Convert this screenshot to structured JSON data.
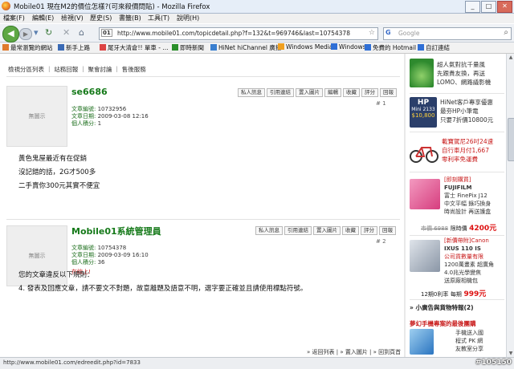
{
  "window": {
    "title": "Mobile01 現在M2的價位怎樣?(可來殺價問貼) - Mozilla Firefox"
  },
  "menu": [
    "檔案(F)",
    "編輯(E)",
    "檢視(V)",
    "歷史(S)",
    "書籤(B)",
    "工具(T)",
    "說明(H)"
  ],
  "nav": {
    "url": "http://www.mobile01.com/topicdetail.php?f=132&t=969746&last=10754378",
    "search_placeholder": "Google",
    "favicon_text": "01"
  },
  "bookmarks": [
    "最常瀏覽的網站",
    "新手上路",
    "尾牙大清倉!! 單車 - ...",
    "即時新聞",
    "HiNet hiChannel 廣播",
    "Windows Media",
    "Windows",
    "免費的 Hotmail",
    "自訂連結"
  ],
  "breadcrumb": "檢視分區列表 ｜ 站務回報 ｜ 聚會討論 ｜ 售後服務",
  "action_buttons": [
    "私人訊息",
    "引用連結",
    "置入圖片",
    "編輯",
    "收藏",
    "評分",
    "回報"
  ],
  "action_buttons_2": [
    "私人訊息",
    "引用連結",
    "置入圖片",
    "收藏",
    "評分",
    "回報"
  ],
  "posts": [
    {
      "author": "se6686",
      "avatar_text": "無圖示",
      "article_id_label": "文章編號:",
      "article_id": "10732956",
      "date_label": "文章日期:",
      "date": "2009-03-08 12:16",
      "points_label": "個人積分:",
      "points": "1",
      "post_no": "# 1",
      "lines": [
        "黃色鬼屋最近有在促銷",
        "沒記錯的話，2G才500多",
        "二手賣你300元其實不便宜"
      ]
    },
    {
      "author": "Mobile01系統管理員",
      "avatar_text": "無圖示",
      "article_id_label": "文章編號:",
      "article_id": "10754378",
      "date_label": "文章日期:",
      "date": "2009-03-09 16:10",
      "points_label": "個人積分:",
      "points": "36",
      "status": "在線上!",
      "post_no": "# 2",
      "lines": [
        "您的文章違反以下規則：",
        "4. 發表及回應文章，請不要文不對題，故意離題及語意不明，選字要正確並且請使用標點符號。"
      ]
    }
  ],
  "bottom_nav": "» 返回列表 | » 置入圖片 | » 回到頁首",
  "sidebar": {
    "ads": [
      {
        "lines": [
          "超人氣對抗千量風",
          "先跟貴友換，再送",
          "LOMO、網路議影機"
        ]
      },
      {
        "pic_text": "HP",
        "pic_sub": "Mini 2133",
        "pic_price": "$10,800",
        "lines": [
          "HiNet客戶專享優惠",
          "最夯HP小筆電",
          "只要7折價10800元"
        ]
      },
      {
        "lines": [
          "載寶駕尼26吋24速",
          "自行車月付1,667",
          "零利率免運費"
        ]
      },
      {
        "lines": [
          "[即刻購買]",
          "FUJIFILM",
          "富士 FinePix J12",
          "中文平幅 錄巧換身",
          "時尚設計 再送護盒"
        ],
        "old_price": "市價 6988",
        "price_label": "限時價",
        "price": "4200元"
      },
      {
        "lines": [
          "[新價帶附]Canon",
          "IXUS 110 IS",
          "公司貨數量有限",
          "1200萬畫素 超廣角",
          "4.0兆光學變焦",
          "送原廠相機包"
        ],
        "old_price": "12期0利率",
        "price_label": "每期",
        "price": "999元"
      }
    ],
    "section_title": "» 小廣告與貨物特報(2)",
    "promo_title": "夢幻手機專案的最後團購",
    "promo_lines": [
      "手機送入國",
      "程式 PK 網",
      "友教室分享"
    ]
  },
  "status_bar": {
    "text": "http://www.mobile01.com/edreedit.php?id=7833",
    "watermark": "#105150"
  }
}
